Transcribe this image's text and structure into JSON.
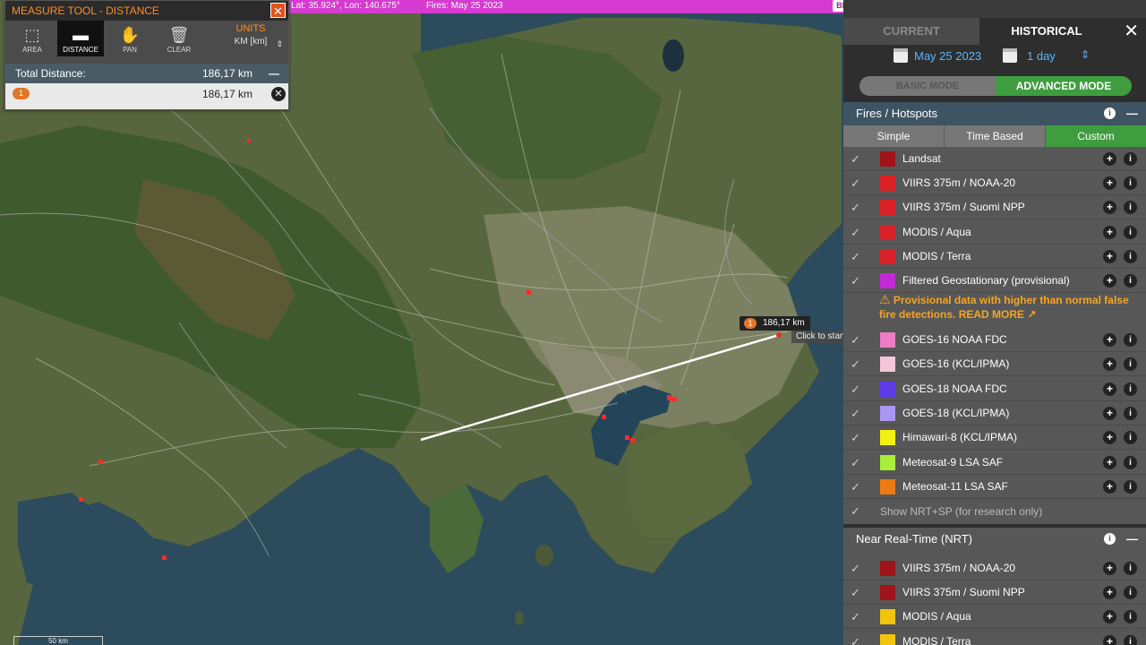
{
  "topbar": {
    "coords": "Lat: 35.924°, Lon: 140.675°",
    "fires": "Fires: May 25 2023",
    "beta": "BETA"
  },
  "measure": {
    "title": "MEASURE TOOL - DISTANCE",
    "tools": [
      {
        "label": "AREA",
        "icon": "area-icon"
      },
      {
        "label": "DISTANCE",
        "icon": "ruler-icon"
      },
      {
        "label": "PAN",
        "icon": "hand-icon"
      },
      {
        "label": "CLEAR",
        "icon": "trash-icon"
      }
    ],
    "units_title": "UNITS",
    "units_value": "KM [km]",
    "total_label": "Total Distance:",
    "total_value": "186,17 km",
    "row_num": "1",
    "row_value": "186,17 km"
  },
  "map": {
    "distance_num": "1",
    "distance_label": "186,17 km",
    "click_hint": "Click to start",
    "scale": "50 km"
  },
  "panel": {
    "tab_current": "CURRENT",
    "tab_historical": "HISTORICAL",
    "date": "May 25 2023",
    "span": "1 day",
    "mode_basic": "BASIC MODE",
    "mode_advanced": "ADVANCED MODE",
    "section_fires": "Fires / Hotspots",
    "subtabs": [
      "Simple",
      "Time Based",
      "Custom"
    ],
    "layers": [
      {
        "label": "Landsat",
        "color": "#a0141a"
      },
      {
        "label": "VIIRS 375m / NOAA-20",
        "color": "#d92026"
      },
      {
        "label": "VIIRS 375m / Suomi NPP",
        "color": "#d92026"
      },
      {
        "label": "MODIS / Aqua",
        "color": "#d92026"
      },
      {
        "label": "MODIS / Terra",
        "color": "#d92026"
      },
      {
        "label": "Filtered Geostationary (provisional)",
        "color": "#c22ad6"
      },
      {
        "label": "GOES-16 NOAA FDC",
        "color": "#ee7bc4"
      },
      {
        "label": "GOES-16 (KCL/IPMA)",
        "color": "#f4c6d8"
      },
      {
        "label": "GOES-18 NOAA FDC",
        "color": "#5c3ae8"
      },
      {
        "label": "GOES-18 (KCL/IPMA)",
        "color": "#a796f2"
      },
      {
        "label": "Himawari-8 (KCL/IPMA)",
        "color": "#f2f20f"
      },
      {
        "label": "Meteosat-9 LSA SAF",
        "color": "#a8ee3a"
      },
      {
        "label": "Meteosat-11 LSA SAF",
        "color": "#ee7a12"
      }
    ],
    "warning": "Provisional data with higher than normal false fire detections. READ MORE",
    "show_nrt_sp": "Show NRT+SP (for research only)",
    "section_nrt": "Near Real-Time (NRT)",
    "nrt_layers": [
      {
        "label": "VIIRS 375m / NOAA-20",
        "color": "#a0141a"
      },
      {
        "label": "VIIRS 375m / Suomi NPP",
        "color": "#a0141a"
      },
      {
        "label": "MODIS / Aqua",
        "color": "#f2c40f"
      },
      {
        "label": "MODIS / Terra",
        "color": "#f2c40f"
      }
    ]
  }
}
